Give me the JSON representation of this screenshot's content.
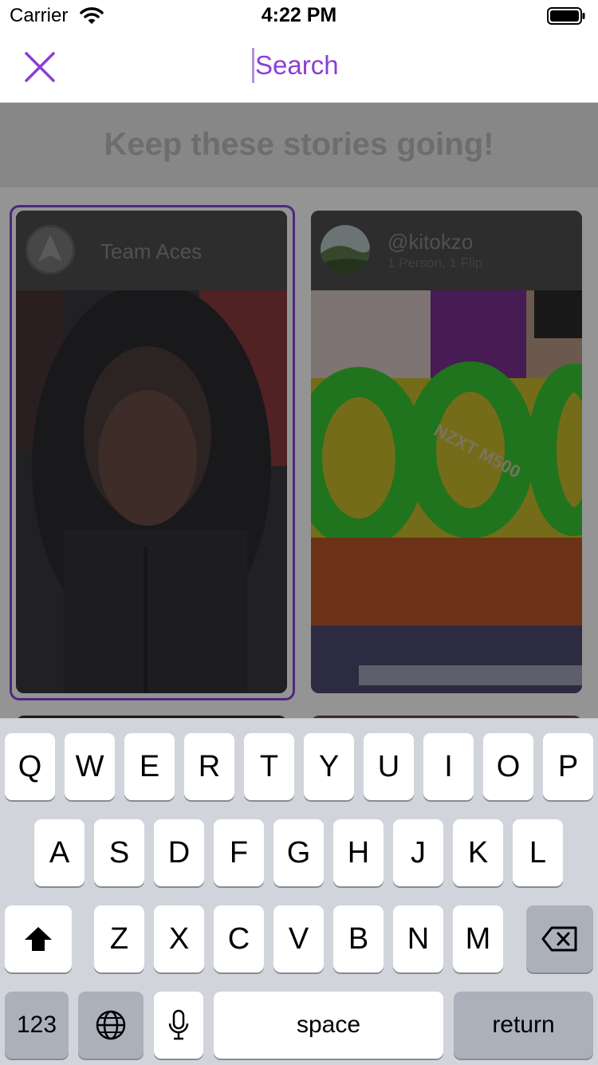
{
  "status_bar": {
    "carrier": "Carrier",
    "time": "4:22 PM"
  },
  "nav": {
    "close_icon": "close-x-icon",
    "search_placeholder": "Search",
    "accent_color": "#8b3fd6"
  },
  "banner": {
    "title": "Keep these stories going!"
  },
  "cards": [
    {
      "name": "Team Aces",
      "subtitle": "",
      "selected": true,
      "avatar_icon": "team-aces-logo-icon"
    },
    {
      "name": "@kitokzo",
      "subtitle": "1 Person, 1 Flip",
      "selected": false,
      "overlay_text": "NZXT M500"
    }
  ],
  "keyboard": {
    "row1": [
      "Q",
      "W",
      "E",
      "R",
      "T",
      "Y",
      "U",
      "I",
      "O",
      "P"
    ],
    "row2": [
      "A",
      "S",
      "D",
      "F",
      "G",
      "H",
      "J",
      "K",
      "L"
    ],
    "row3": [
      "Z",
      "X",
      "C",
      "V",
      "B",
      "N",
      "M"
    ],
    "numbers_label": "123",
    "space_label": "space",
    "return_label": "return",
    "shift_icon": "shift-arrow-icon",
    "delete_icon": "backspace-icon",
    "globe_icon": "globe-icon",
    "mic_icon": "microphone-icon"
  }
}
